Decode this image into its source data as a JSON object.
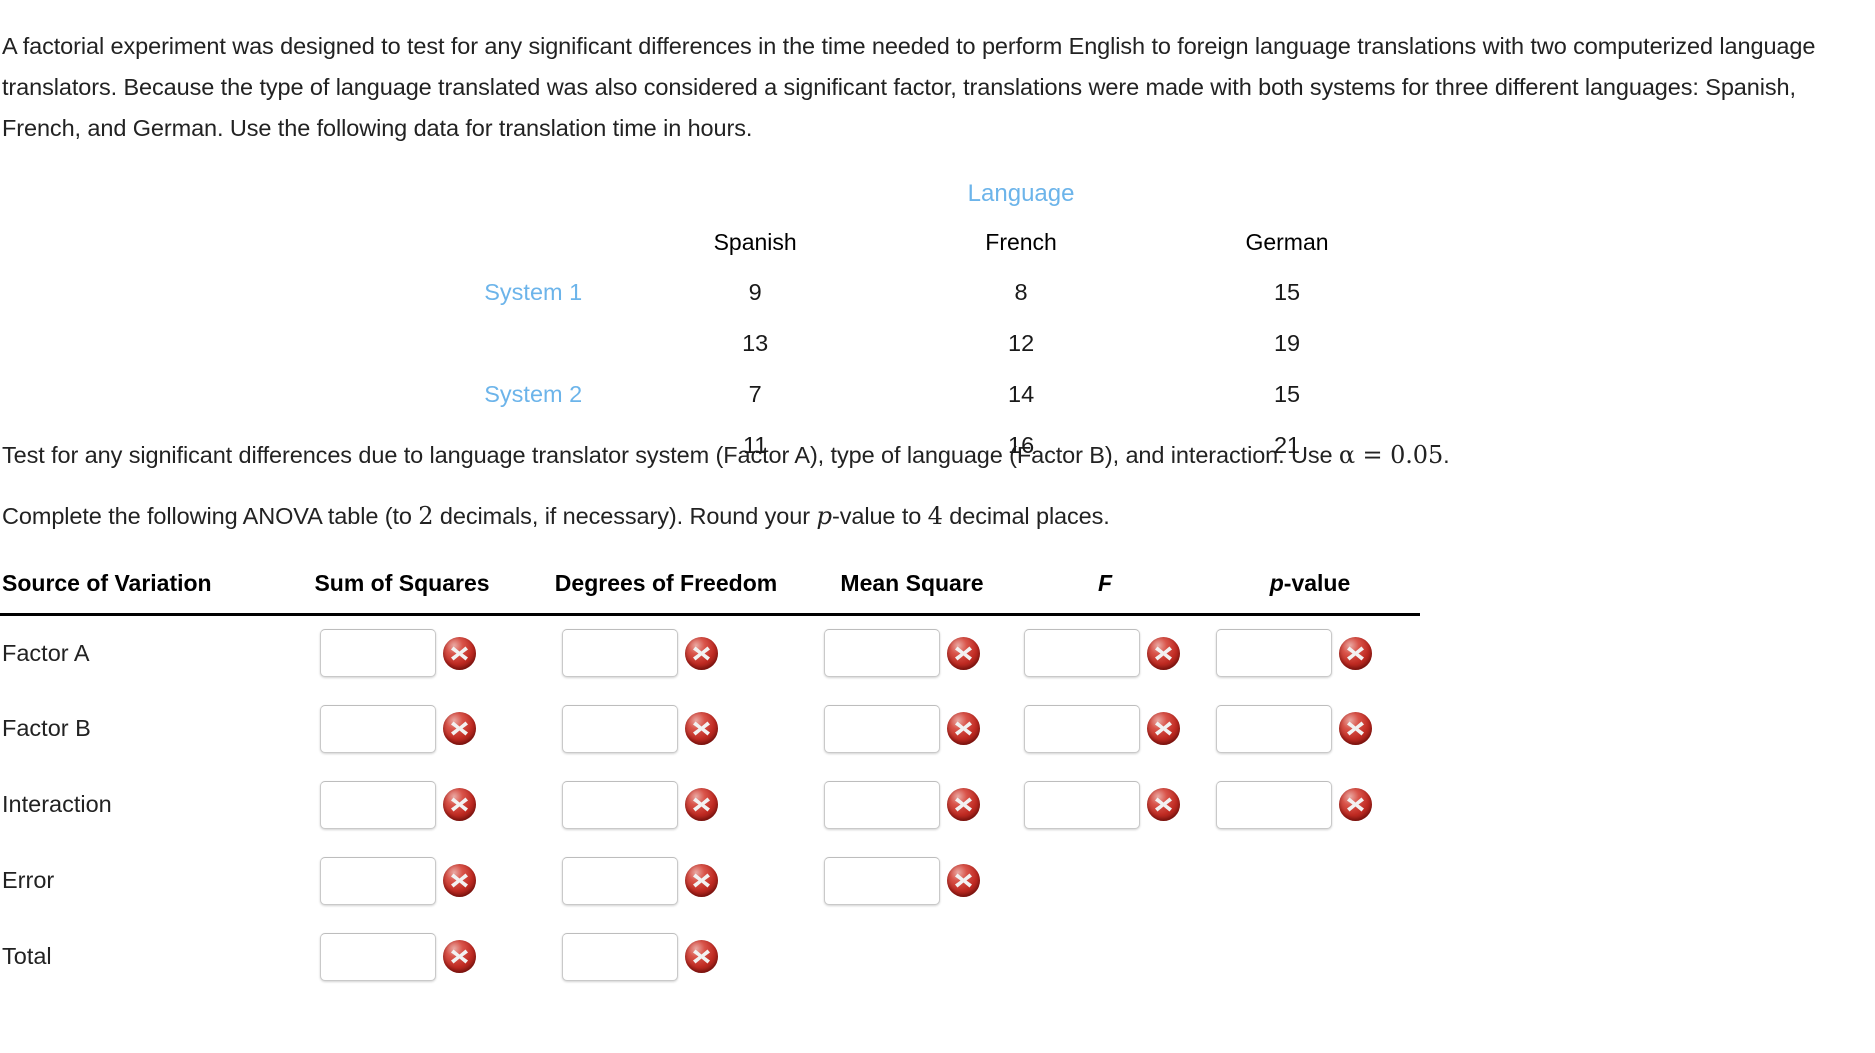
{
  "colors": {
    "accent_blue": "#6cb4ea",
    "error_red": "#bf2a22",
    "text": "#222222"
  },
  "intro": {
    "paragraph": "A factorial experiment was designed to test for any significant differences in the time needed to perform English to foreign language translations with two computerized language translators. Because the type of language translated was also considered a significant factor, translations were made with both systems for three different languages: Spanish, French, and German. Use the following data for translation time in hours."
  },
  "data_table": {
    "group_header": "Language",
    "column_headers": [
      "Spanish",
      "French",
      "German"
    ],
    "rows": [
      {
        "label": "System 1",
        "values": [
          "9",
          "8",
          "15"
        ]
      },
      {
        "label": "",
        "values": [
          "13",
          "12",
          "19"
        ]
      },
      {
        "label": "System 2",
        "values": [
          "7",
          "14",
          "15"
        ]
      },
      {
        "label": "",
        "values": [
          "11",
          "16",
          "21"
        ]
      }
    ]
  },
  "prompts": {
    "test_line_part1": "Test for any significant differences due to language translator system (Factor A), type of language (Factor B), and interaction. Use",
    "alpha_expr": "α = 0.05",
    "test_line_end": ".",
    "complete_part1": "Complete the following ANOVA table (to",
    "decimals_value": "2",
    "complete_part2": "decimals, if necessary). Round your",
    "p_italic": "p",
    "complete_part3": "-value to",
    "round_value": "4",
    "complete_part4": "decimal places."
  },
  "anova": {
    "headers": {
      "source": "Source of Variation",
      "sum_of_squares": "Sum of Squares",
      "degrees_of_freedom": "Degrees of Freedom",
      "mean_square": "Mean Square",
      "f": "F",
      "p_value_italic": "p",
      "p_value_rest": "-value"
    },
    "rows": [
      {
        "source": "Factor A",
        "ss": "",
        "df": "",
        "ms": "",
        "f": "",
        "p": "",
        "fields": [
          "ss",
          "df",
          "ms",
          "f",
          "p"
        ]
      },
      {
        "source": "Factor B",
        "ss": "",
        "df": "",
        "ms": "",
        "f": "",
        "p": "",
        "fields": [
          "ss",
          "df",
          "ms",
          "f",
          "p"
        ]
      },
      {
        "source": "Interaction",
        "ss": "",
        "df": "",
        "ms": "",
        "f": "",
        "p": "",
        "fields": [
          "ss",
          "df",
          "ms",
          "f",
          "p"
        ]
      },
      {
        "source": "Error",
        "ss": "",
        "df": "",
        "ms": "",
        "fields": [
          "ss",
          "df",
          "ms"
        ]
      },
      {
        "source": "Total",
        "ss": "",
        "df": "",
        "fields": [
          "ss",
          "df"
        ]
      }
    ],
    "status_icon": "error-x-icon"
  }
}
